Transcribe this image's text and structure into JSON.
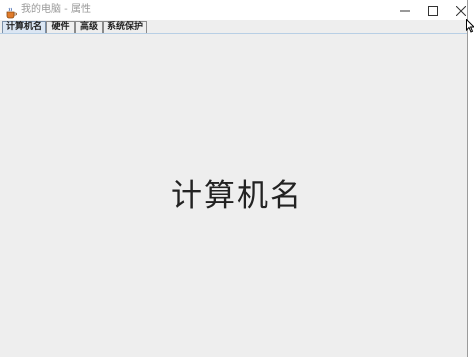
{
  "window": {
    "title": "我的电脑 - 属性",
    "icons": {
      "app": "java-cup-icon",
      "minimize": "minimize-icon",
      "maximize": "maximize-icon",
      "close": "close-icon"
    }
  },
  "tabs": [
    {
      "label": "计算机名",
      "selected": true
    },
    {
      "label": "硬件",
      "selected": false
    },
    {
      "label": "高级",
      "selected": false
    },
    {
      "label": "系统保护",
      "selected": false
    }
  ],
  "content": {
    "heading": "计算机名"
  },
  "colors": {
    "tab_selected_bg": "#dbe6f3",
    "window_bg": "#eeeeee",
    "title_text": "#999999"
  }
}
